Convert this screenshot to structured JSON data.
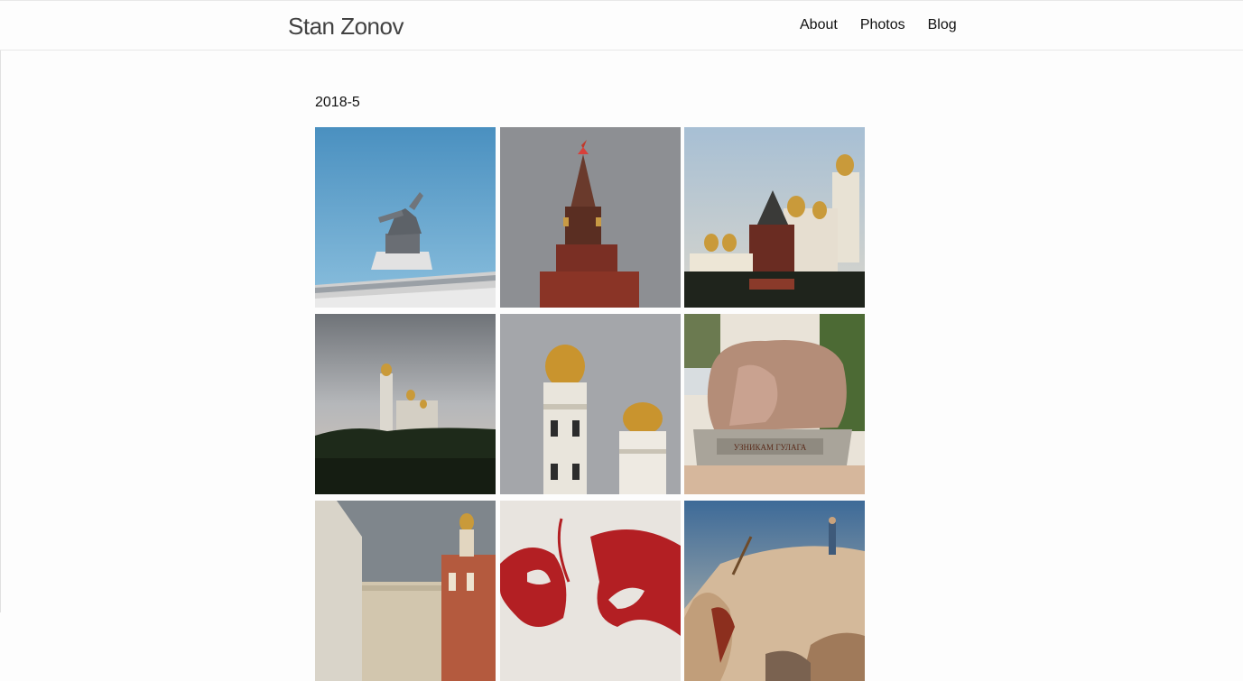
{
  "site": {
    "title": "Stan Zonov"
  },
  "nav": {
    "items": [
      "About",
      "Photos",
      "Blog"
    ]
  },
  "album": {
    "heading": "2018-5",
    "photos": [
      {
        "subject": "worker-and-kolkhoz-woman-statue"
      },
      {
        "subject": "spasskaya-tower"
      },
      {
        "subject": "kremlin-cathedrals"
      },
      {
        "subject": "ivan-the-great-bell-tower-distant"
      },
      {
        "subject": "ivan-the-great-bell-tower-domes"
      },
      {
        "subject": "solovetsky-stone",
        "inscription": "УЗНИКАМ ГУЛАГА"
      },
      {
        "subject": "kremlin-palace-street"
      },
      {
        "subject": "red-mosaic"
      },
      {
        "subject": "painting-appearance-of-christ"
      }
    ]
  }
}
